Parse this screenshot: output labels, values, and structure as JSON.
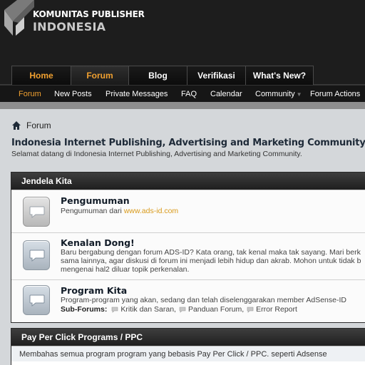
{
  "logo": {
    "line1": "KOMUNITAS PUBLISHER",
    "line2": "INDONESIA"
  },
  "main_tabs": [
    {
      "label": "Home"
    },
    {
      "label": "Forum"
    },
    {
      "label": "Blog"
    },
    {
      "label": "Verifikasi"
    },
    {
      "label": "What's New?"
    }
  ],
  "sub_nav": [
    {
      "label": "Forum"
    },
    {
      "label": "New Posts"
    },
    {
      "label": "Private Messages"
    },
    {
      "label": "FAQ"
    },
    {
      "label": "Calendar"
    },
    {
      "label": "Community"
    },
    {
      "label": "Forum Actions"
    }
  ],
  "breadcrumb": {
    "label": "Forum"
  },
  "page": {
    "title": "Indonesia Internet Publishing, Advertising and Marketing Community",
    "description": "Selamat datang di Indonesia Internet Publishing, Advertising and Marketing Community."
  },
  "category1": {
    "title": "Jendela Kita",
    "forums": [
      {
        "title": "Pengumuman",
        "desc_prefix": "Pengumuman dari ",
        "desc_link": "www.ads-id.com"
      },
      {
        "title": "Kenalan Dong!",
        "desc_lines": [
          "Baru bergabung dengan forum ADS-ID? Kata orang, tak kenal maka tak sayang. Mari berk",
          "sama lainnya, agar diskusi di forum ini menjadi lebih hidup dan akrab. Mohon untuk tidak b",
          "mengenai hal2 diluar topik perkenalan."
        ]
      },
      {
        "title": "Program Kita",
        "desc": "Program-program yang akan, sedang dan telah diselenggarakan member AdSense-ID",
        "subforums_label": "Sub-Forums:",
        "subforums": [
          "Kritik dan Saran,",
          "Panduan Forum,",
          "Error Report"
        ]
      }
    ]
  },
  "category2": {
    "title": "Pay Per Click Programs / PPC",
    "description": "Membahas semua program program yang bebasis Pay Per Click / PPC. seperti Adsense"
  },
  "colors": {
    "accent_orange": "#f0a030",
    "link_orange": "#d99a1a",
    "header_bg": "#1d1d1d"
  }
}
